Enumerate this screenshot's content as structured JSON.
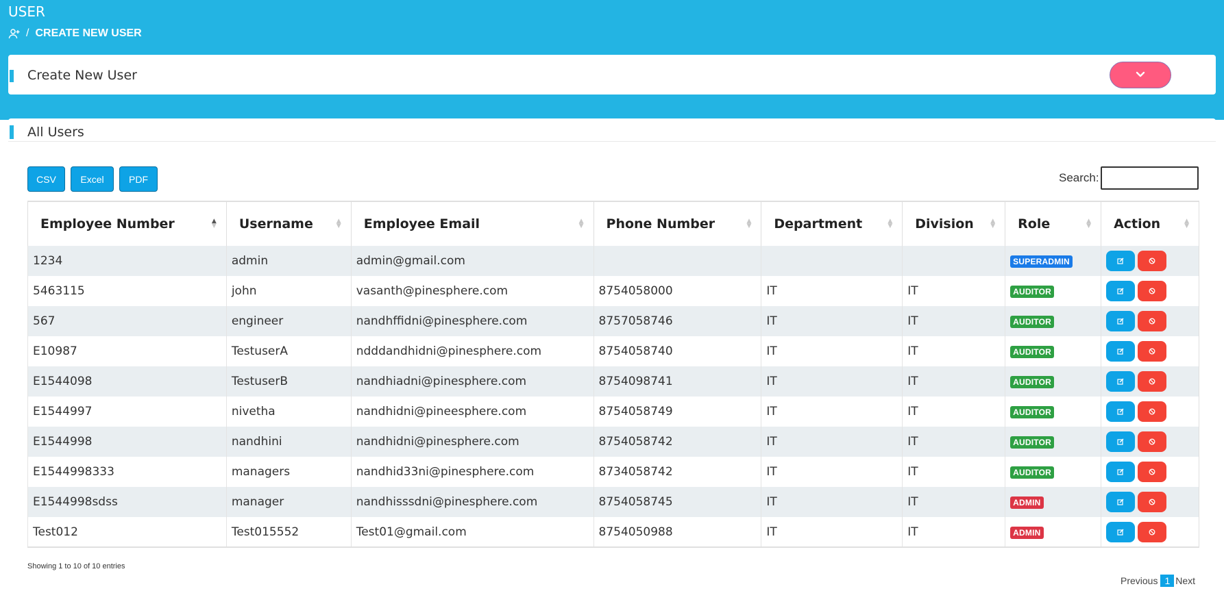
{
  "header": {
    "title": "USER",
    "breadcrumb": {
      "icon": "user-plus-icon",
      "separator": "/",
      "current": "CREATE NEW USER"
    }
  },
  "create_card": {
    "title": "Create New User",
    "toggle_icon": "chevron-down-icon"
  },
  "users_card": {
    "title": "All Users",
    "exports": {
      "csv": "CSV",
      "excel": "Excel",
      "pdf": "PDF"
    },
    "search": {
      "label": "Search:",
      "value": "",
      "placeholder": ""
    },
    "columns": [
      "Employee Number",
      "Username",
      "Employee Email",
      "Phone Number",
      "Department",
      "Division",
      "Role",
      "Action"
    ],
    "rows": [
      {
        "employee_number": "1234",
        "username": "admin",
        "email": "admin@gmail.com",
        "phone": "",
        "department": "",
        "division": "",
        "role": "SUPERADMIN",
        "role_color": "#1a7be8"
      },
      {
        "employee_number": "5463115",
        "username": "john",
        "email": "vasanth@pinesphere.com",
        "phone": "8754058000",
        "department": "IT",
        "division": "IT",
        "role": "AUDITOR",
        "role_color": "#2ea043"
      },
      {
        "employee_number": "567",
        "username": "engineer",
        "email": "nandhffidni@pinesphere.com",
        "phone": "8757058746",
        "department": "IT",
        "division": "IT",
        "role": "AUDITOR",
        "role_color": "#2ea043"
      },
      {
        "employee_number": "E10987",
        "username": "TestuserA",
        "email": "ndddandhidni@pinesphere.com",
        "phone": "8754058740",
        "department": "IT",
        "division": "IT",
        "role": "AUDITOR",
        "role_color": "#2ea043"
      },
      {
        "employee_number": "E1544098",
        "username": "TestuserB",
        "email": "nandhiadni@pinesphere.com",
        "phone": "8754098741",
        "department": "IT",
        "division": "IT",
        "role": "AUDITOR",
        "role_color": "#2ea043"
      },
      {
        "employee_number": "E1544997",
        "username": "nivetha",
        "email": "nandhidni@pineesphere.com",
        "phone": "8754058749",
        "department": "IT",
        "division": "IT",
        "role": "AUDITOR",
        "role_color": "#2ea043"
      },
      {
        "employee_number": "E1544998",
        "username": "nandhini",
        "email": "nandhidni@pinesphere.com",
        "phone": "8754058742",
        "department": "IT",
        "division": "IT",
        "role": "AUDITOR",
        "role_color": "#2ea043"
      },
      {
        "employee_number": "E1544998333",
        "username": "managers",
        "email": "nandhid33ni@pinesphere.com",
        "phone": "8734058742",
        "department": "IT",
        "division": "IT",
        "role": "AUDITOR",
        "role_color": "#2ea043"
      },
      {
        "employee_number": "E1544998sdss",
        "username": "manager",
        "email": "nandhisssdni@pinesphere.com",
        "phone": "8754058745",
        "department": "IT",
        "division": "IT",
        "role": "ADMIN",
        "role_color": "#dc3545"
      },
      {
        "employee_number": "Test012",
        "username": "Test015552",
        "email": "Test01@gmail.com",
        "phone": "8754050988",
        "department": "IT",
        "division": "IT",
        "role": "ADMIN",
        "role_color": "#dc3545"
      }
    ],
    "row_actions": {
      "edit_icon": "edit-icon",
      "block_icon": "ban-icon"
    },
    "info": "Showing 1 to 10 of 10 entries",
    "pagination": {
      "previous": "Previous",
      "current": "1",
      "next": "Next"
    }
  },
  "colors": {
    "accent": "#23b4e3",
    "toggle": "#ff5a7f",
    "primary": "#0ea3e6",
    "danger": "#f44336"
  }
}
